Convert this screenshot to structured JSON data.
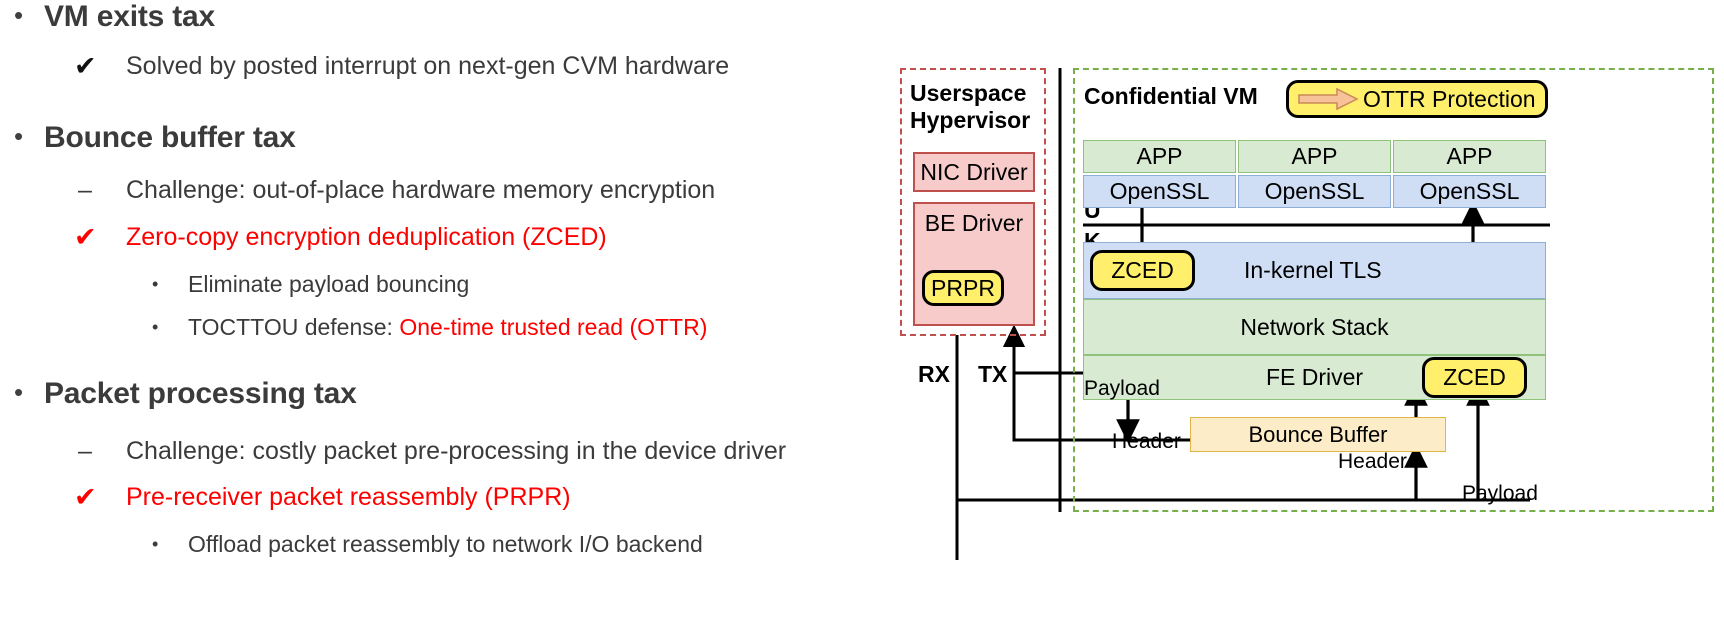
{
  "slide": {
    "bullets": [
      {
        "level": 1,
        "marker": "•",
        "text": "VM exits tax",
        "color": "dark"
      },
      {
        "level": 2,
        "marker": "✔",
        "text": "Solved by posted interrupt on next-gen CVM hardware",
        "color": "dark"
      },
      {
        "level": 1,
        "marker": "•",
        "text": "Bounce buffer tax",
        "color": "dark"
      },
      {
        "level": 2,
        "marker": "–",
        "text": "Challenge: out-of-place hardware memory encryption",
        "color": "dark"
      },
      {
        "level": 2,
        "marker": "✔",
        "text": "Zero-copy encryption deduplication (ZCED)",
        "color": "red"
      },
      {
        "level": 3,
        "marker": "•",
        "text": "Eliminate payload bouncing",
        "color": "dark"
      },
      {
        "level": 3,
        "marker": "•",
        "text_plain": "TOCTTOU defense: ",
        "text_red": "One-time trusted read (OTTR)",
        "color": "mixed"
      },
      {
        "level": 1,
        "marker": "•",
        "text": "Packet processing tax",
        "color": "dark"
      },
      {
        "level": 2,
        "marker": "–",
        "text": "Challenge: costly packet pre-processing in the device driver",
        "color": "dark"
      },
      {
        "level": 2,
        "marker": "✔",
        "text": "Pre-receiver packet reassembly (PRPR)",
        "color": "red"
      },
      {
        "level": 3,
        "marker": "•",
        "text": "Offload packet reassembly to network I/O backend",
        "color": "dark"
      }
    ]
  },
  "diagram": {
    "hypervisor": {
      "title_line1": "Userspace",
      "title_line2": "Hypervisor",
      "nic_driver": "NIC Driver",
      "be_driver": "BE Driver",
      "prpr": "PRPR"
    },
    "cvm": {
      "title": "Confidential VM",
      "legend": "OTTR Protection",
      "apps": [
        "APP",
        "APP",
        "APP"
      ],
      "ssl": [
        "OpenSSL",
        "OpenSSL",
        "OpenSSL"
      ],
      "user_label": "U",
      "kernel_label": "K",
      "zced_top": "ZCED",
      "in_kernel_tls": "In-kernel TLS",
      "network_stack": "Network Stack",
      "fe_driver": "FE Driver",
      "zced_bottom": "ZCED",
      "bounce_buffer": "Bounce Buffer",
      "payload_left": "Payload",
      "header_left": "Header",
      "header_right": "Header",
      "payload_right": "Payload"
    },
    "io": {
      "rx": "RX",
      "tx": "TX"
    },
    "colors": {
      "red_accent": "#ff0000",
      "pink_fill": "#f8cbcb",
      "pink_border": "#c0504d",
      "green_fill": "#d9ead3",
      "green_border": "#77b04a",
      "blue_fill": "#cfdef5",
      "yellow_fill": "#ffef6b",
      "orange_fill": "#fdecc8",
      "arrow_orange": "#f7c19a"
    }
  }
}
